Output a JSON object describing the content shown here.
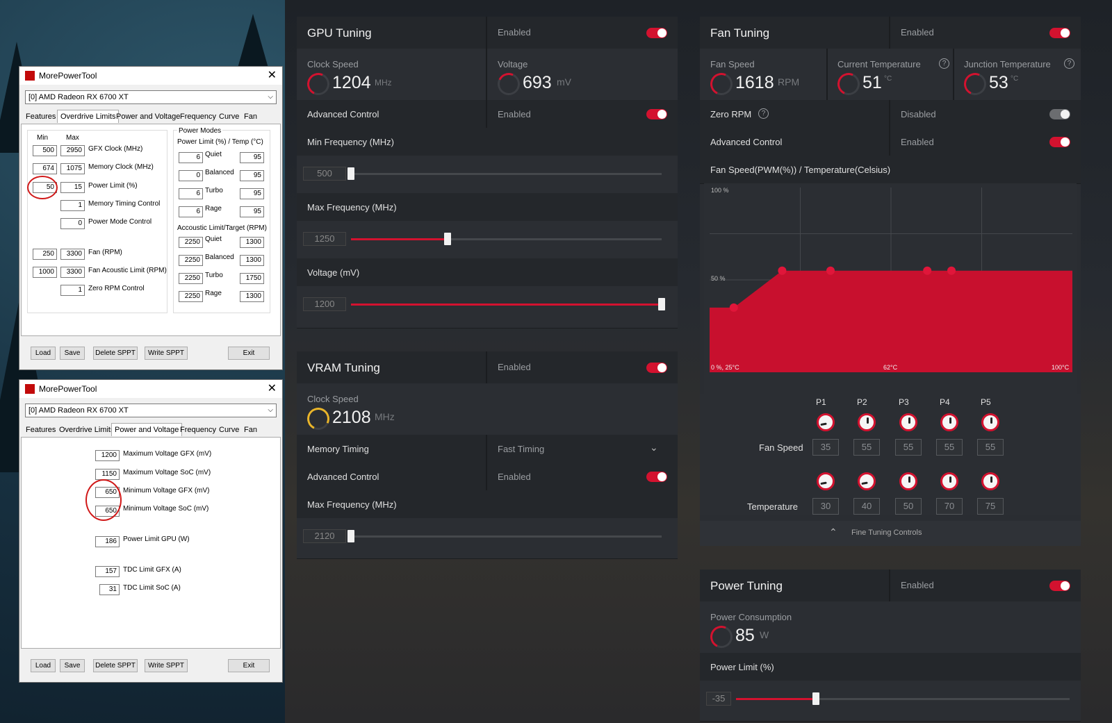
{
  "mpt1": {
    "title": "MorePowerTool",
    "device": "[0] AMD Radeon RX 6700 XT",
    "tabs": [
      "Features",
      "Overdrive Limits",
      "Power and Voltage",
      "Frequency",
      "Curve",
      "Fan"
    ],
    "selected_tab": "Overdrive Limits",
    "col_min": "Min",
    "col_max": "Max",
    "limits": [
      {
        "min": "500",
        "max": "2950",
        "label": "GFX Clock (MHz)"
      },
      {
        "min": "674",
        "max": "1075",
        "label": "Memory Clock (MHz)"
      },
      {
        "min": "50",
        "max": "15",
        "label": "Power Limit (%)"
      },
      {
        "min": "",
        "max": "1",
        "label": "Memory Timing Control"
      },
      {
        "min": "",
        "max": "0",
        "label": "Power Mode Control"
      },
      {
        "min": "250",
        "max": "3300",
        "label": "Fan (RPM)"
      },
      {
        "min": "1000",
        "max": "3300",
        "label": "Fan Acoustic Limit (RPM)"
      },
      {
        "min": "",
        "max": "1",
        "label": "Zero RPM Control"
      }
    ],
    "power_modes_title": "Power Modes",
    "power_limit_title": "Power Limit (%) / Temp (°C)",
    "power_modes": [
      {
        "a": "6",
        "name": "Quiet",
        "b": "95"
      },
      {
        "a": "0",
        "name": "Balanced",
        "b": "95"
      },
      {
        "a": "6",
        "name": "Turbo",
        "b": "95"
      },
      {
        "a": "6",
        "name": "Rage",
        "b": "95"
      }
    ],
    "acoustic_title": "Accoustic Limit/Target (RPM)",
    "acoustic": [
      {
        "a": "2250",
        "name": "Quiet",
        "b": "1300"
      },
      {
        "a": "2250",
        "name": "Balanced",
        "b": "1300"
      },
      {
        "a": "2250",
        "name": "Turbo",
        "b": "1750"
      },
      {
        "a": "2250",
        "name": "Rage",
        "b": "1300"
      }
    ],
    "buttons": {
      "load": "Load",
      "save": "Save",
      "delete": "Delete SPPT",
      "write": "Write SPPT",
      "exit": "Exit"
    }
  },
  "mpt2": {
    "title": "MorePowerTool",
    "device": "[0] AMD Radeon RX 6700 XT",
    "tabs": [
      "Features",
      "Overdrive Limits",
      "Power and Voltage",
      "Frequency",
      "Curve",
      "Fan"
    ],
    "selected_tab": "Power and Voltage",
    "fields": [
      {
        "value": "1200",
        "label": "Maximum Voltage GFX (mV)"
      },
      {
        "value": "1150",
        "label": "Maximum Voltage SoC (mV)"
      },
      {
        "value": "650",
        "label": "Minimum Voltage GFX (mV)"
      },
      {
        "value": "650",
        "label": "Minimum Voltage SoC (mV)"
      },
      {
        "value": "186",
        "label": "Power Limit GPU (W)"
      },
      {
        "value": "157",
        "label": "TDC Limit GFX (A)"
      },
      {
        "value": "31",
        "label": "TDC Limit SoC (A)"
      }
    ],
    "buttons": {
      "load": "Load",
      "save": "Save",
      "delete": "Delete SPPT",
      "write": "Write SPPT",
      "exit": "Exit"
    }
  },
  "gpu": {
    "title": "GPU Tuning",
    "state": "Enabled",
    "clock_label": "Clock Speed",
    "clock_value": "1204",
    "clock_unit": "MHz",
    "voltage_label": "Voltage",
    "voltage_value": "693",
    "voltage_unit": "mV",
    "adv_label": "Advanced Control",
    "adv_state": "Enabled",
    "min_freq_label": "Min Frequency (MHz)",
    "min_freq_value": "500",
    "min_freq_pos": 0,
    "max_freq_label": "Max Frequency (MHz)",
    "max_freq_value": "1250",
    "max_freq_pos": 0.31,
    "voltage_slider_label": "Voltage (mV)",
    "voltage_slider_value": "1200",
    "voltage_slider_pos": 1.0
  },
  "vram": {
    "title": "VRAM Tuning",
    "state": "Enabled",
    "clock_label": "Clock Speed",
    "clock_value": "2108",
    "clock_unit": "MHz",
    "timing_label": "Memory Timing",
    "timing_value": "Fast Timing",
    "adv_label": "Advanced Control",
    "adv_state": "Enabled",
    "max_freq_label": "Max Frequency (MHz)",
    "max_freq_value": "2120",
    "max_freq_pos": 0
  },
  "fan": {
    "title": "Fan Tuning",
    "state": "Enabled",
    "speed_label": "Fan Speed",
    "speed_value": "1618",
    "speed_unit": "RPM",
    "temp_label": "Current Temperature",
    "temp_value": "51",
    "temp_unit": "°C",
    "junction_label": "Junction Temperature",
    "junction_value": "53",
    "junction_unit": "°C",
    "zero_rpm_label": "Zero RPM",
    "zero_rpm_state": "Disabled",
    "adv_label": "Advanced Control",
    "adv_state": "Enabled",
    "curve_title": "Fan Speed(PWM(%)) / Temperature(Celsius)",
    "curve_labels": {
      "top": "100 %",
      "mid": "50 %",
      "origin": "0 %, 25°C",
      "x_mid": "62°C",
      "x_max": "100°C"
    },
    "points_header": [
      "P1",
      "P2",
      "P3",
      "P4",
      "P5"
    ],
    "fan_speed_row_label": "Fan Speed",
    "fan_speeds": [
      "35",
      "55",
      "55",
      "55",
      "55"
    ],
    "temperature_row_label": "Temperature",
    "temperatures": [
      "30",
      "40",
      "50",
      "70",
      "75"
    ],
    "fine_tuning": "Fine Tuning Controls"
  },
  "chart_data": {
    "type": "area",
    "title": "Fan Speed(PWM(%)) / Temperature(Celsius)",
    "x": [
      30,
      40,
      50,
      70,
      75
    ],
    "y": [
      35,
      55,
      55,
      55,
      55
    ],
    "xlim": [
      25,
      100
    ],
    "ylim": [
      0,
      100
    ],
    "tick_labels": {
      "y": [
        "100 %",
        "50 %",
        "0 %"
      ],
      "x": [
        "25°C",
        "62°C",
        "100°C"
      ]
    },
    "grid": true
  },
  "power": {
    "title": "Power Tuning",
    "state": "Enabled",
    "consumption_label": "Power Consumption",
    "consumption_value": "85",
    "consumption_unit": "W",
    "limit_label": "Power Limit (%)",
    "limit_value": "-35",
    "limit_pos": 0.24
  },
  "colors": {
    "accent": "#d3122f",
    "vram_gauge": "#e9b52a",
    "annotation": "#d01818"
  }
}
